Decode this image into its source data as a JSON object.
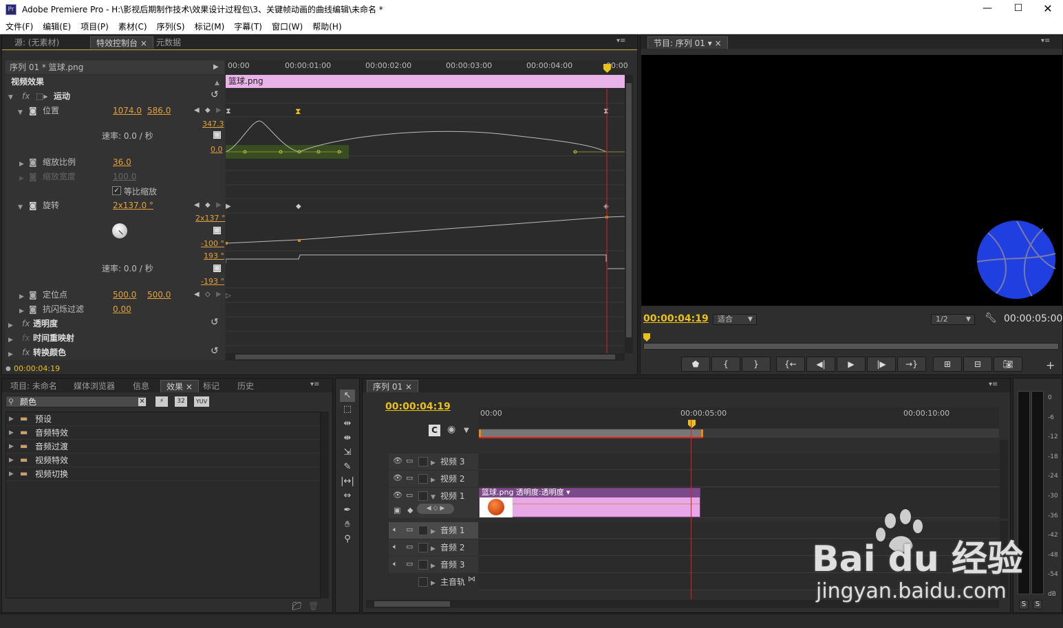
{
  "window": {
    "title": "Adobe Premiere Pro - H:\\影视后期制作技术\\效果设计过程包\\3、关键帧动画的曲线编辑\\未命名 *",
    "app_icon": "Pr"
  },
  "menu": [
    "文件(F)",
    "编辑(E)",
    "项目(P)",
    "素材(C)",
    "序列(S)",
    "标记(M)",
    "字幕(T)",
    "窗口(W)",
    "帮助(H)"
  ],
  "effect_controls": {
    "tabs": [
      "源: (无素材)",
      "特效控制台",
      "元数据"
    ],
    "sequence_label": "序列 01 * 篮球.png",
    "clip_bar_label": "篮球.png",
    "ruler": [
      "00:00",
      "00:00:01:00",
      "00:00:02:00",
      "00:00:03:00",
      "00:00:04:00",
      "00:00"
    ],
    "video_effects_label": "视频效果",
    "motion_label": "运动",
    "position": {
      "label": "位置",
      "x": "1074.0",
      "y": "586.0",
      "velocity": "速率: 0.0 / 秒",
      "graph_max": "347.3",
      "graph_min": "0.0"
    },
    "scale": {
      "label": "缩放比例",
      "value": "36.0"
    },
    "scale_width": {
      "label": "缩放宽度",
      "value": "100.0"
    },
    "uniform_scale": {
      "label": "等比缩放",
      "checked": true
    },
    "rotation": {
      "label": "旋转",
      "value": "2x137.0 °",
      "graph_max": "2x137 °",
      "graph_min": "-100 °",
      "vel_max": "193 °",
      "vel_min": "-193 °",
      "velocity": "速率: 0.0 / 秒"
    },
    "anchor": {
      "label": "定位点",
      "x": "500.0",
      "y": "500.0"
    },
    "anti_flicker": {
      "label": "抗闪烁过滤",
      "value": "0.00"
    },
    "opacity_label": "透明度",
    "time_remap_label": "时间重映射",
    "color_replace_label": "转换颜色",
    "timecode": "00:00:04:19"
  },
  "program_monitor": {
    "tab": "节目: 序列 01",
    "timecode": "00:00:04:19",
    "fit": "适合",
    "resolution": "1/2",
    "duration": "00:00:05:00",
    "ball_color": "#1f3fe0"
  },
  "project_panel": {
    "tabs": [
      "项目: 未命名",
      "媒体浏览器",
      "信息",
      "效果",
      "标记",
      "历史"
    ],
    "search_value": "颜色",
    "badges": [
      "32",
      "YUV"
    ],
    "folders": [
      "预设",
      "音频特效",
      "音频过渡",
      "视频特效",
      "视频切换"
    ]
  },
  "timeline": {
    "tab": "序列 01",
    "timecode": "00:00:04:19",
    "ruler": [
      "00:00",
      "00:00:05:00",
      "00:00:10:00"
    ],
    "video_tracks": [
      "视频 3",
      "视频 2",
      "视频 1"
    ],
    "audio_tracks": [
      "音频 1",
      "音频 2",
      "音频 3"
    ],
    "master_track": "主音轨",
    "clip_label": "篮球.png 透明度:透明度 ▾",
    "clip_color": "#e8a8e8"
  },
  "audio_meter": {
    "scale": [
      "0",
      "-6",
      "-12",
      "-18",
      "-24",
      "-30",
      "-36",
      "-42",
      "-48",
      "-54",
      "dB"
    ],
    "solo": [
      "S",
      "S"
    ]
  },
  "watermark": {
    "brand": "Bai du 经验",
    "url": "jingyan.baidu.com"
  },
  "colors": {
    "accent_timecode": "#e8c21a",
    "value_orange": "#e6a23a",
    "playhead": "#e02020"
  }
}
